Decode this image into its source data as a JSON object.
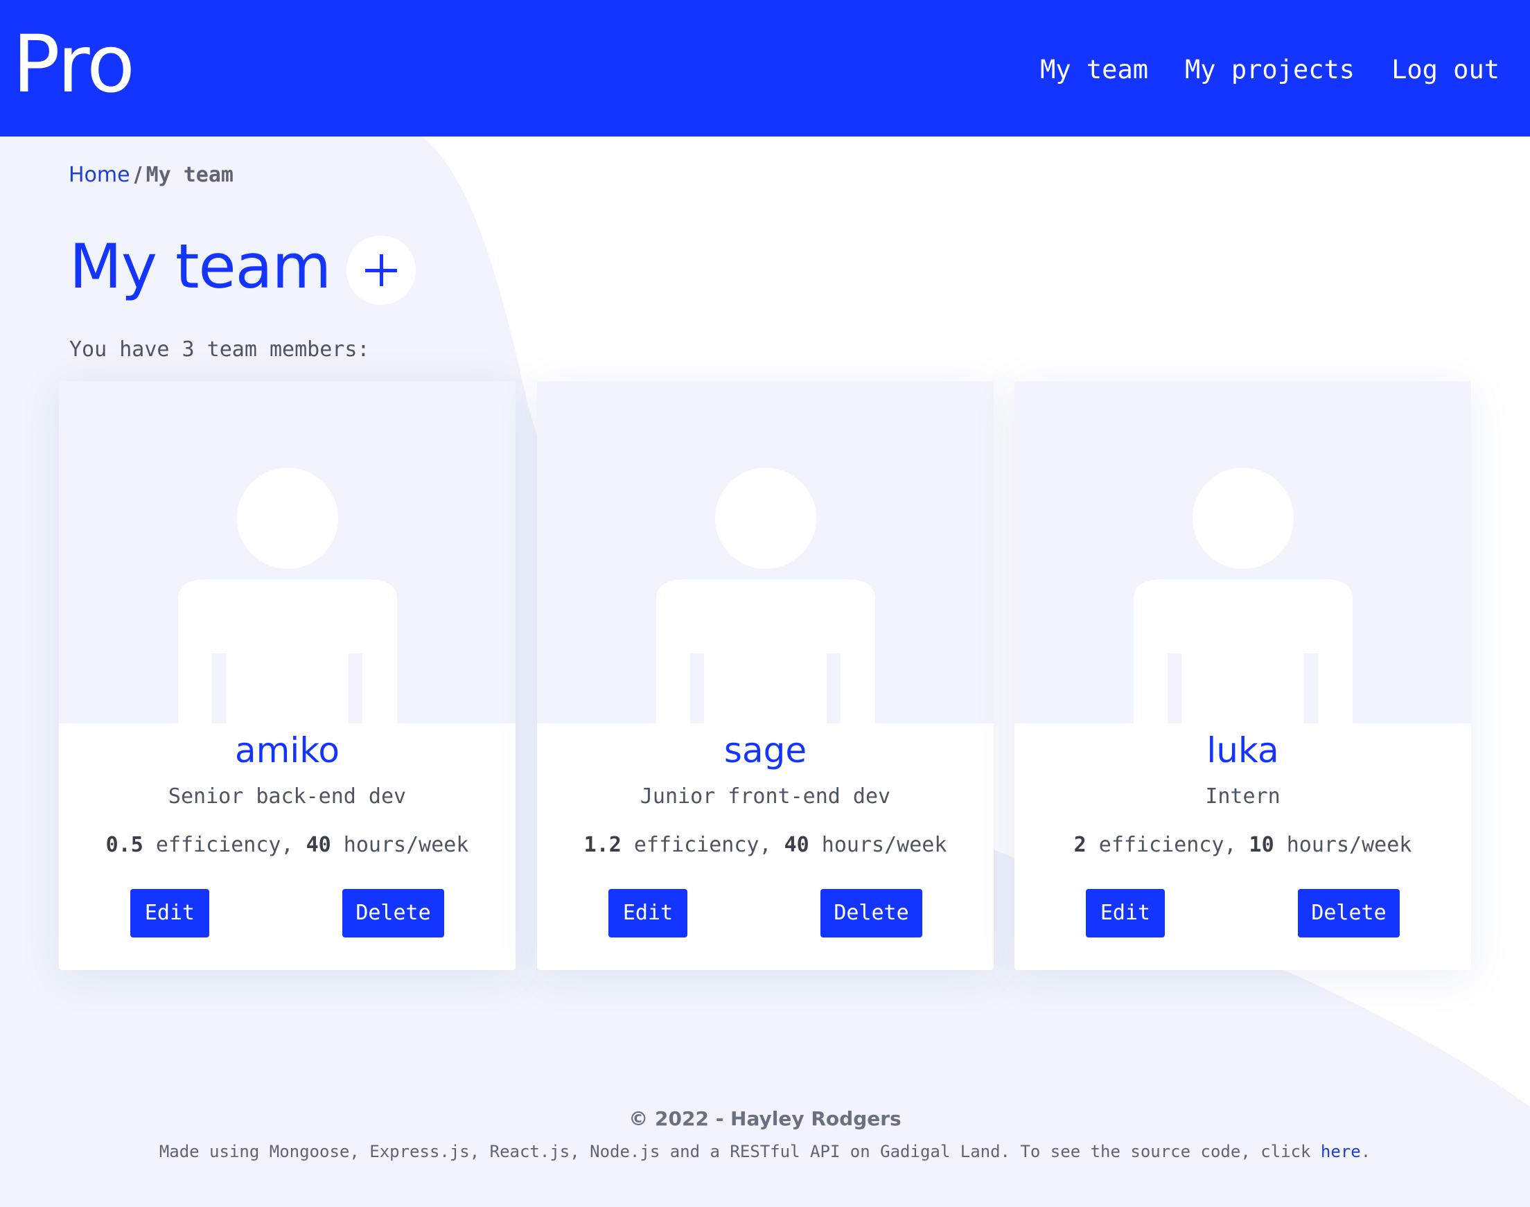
{
  "header": {
    "logo": "Pro",
    "nav": [
      "My team",
      "My projects",
      "Log out"
    ]
  },
  "breadcrumb": {
    "home": "Home",
    "separator": "/",
    "current": "My team"
  },
  "page": {
    "title": "My team",
    "add_icon": "plus-icon",
    "member_count_text": "You have 3 team members:"
  },
  "members": [
    {
      "name": "amiko",
      "role": "Senior back-end dev",
      "efficiency": "0.5",
      "hours": "40",
      "edit_label": "Edit",
      "delete_label": "Delete"
    },
    {
      "name": "sage",
      "role": "Junior front-end dev",
      "efficiency": "1.2",
      "hours": "40",
      "edit_label": "Edit",
      "delete_label": "Delete"
    },
    {
      "name": "luka",
      "role": "Intern",
      "efficiency": "2",
      "hours": "10",
      "edit_label": "Edit",
      "delete_label": "Delete"
    }
  ],
  "stats_labels": {
    "efficiency": " efficiency, ",
    "hours": " hours/week"
  },
  "footer": {
    "copyright": "© 2022 - Hayley Rodgers",
    "note": "Made using Mongoose, Express.js, React.js, Node.js and a RESTful API on Gadigal Land. To see the source code, click ",
    "link": "here",
    "end": "."
  },
  "colors": {
    "accent": "#1434ff",
    "background": "#f1f4fc",
    "card": "#ffffff"
  }
}
